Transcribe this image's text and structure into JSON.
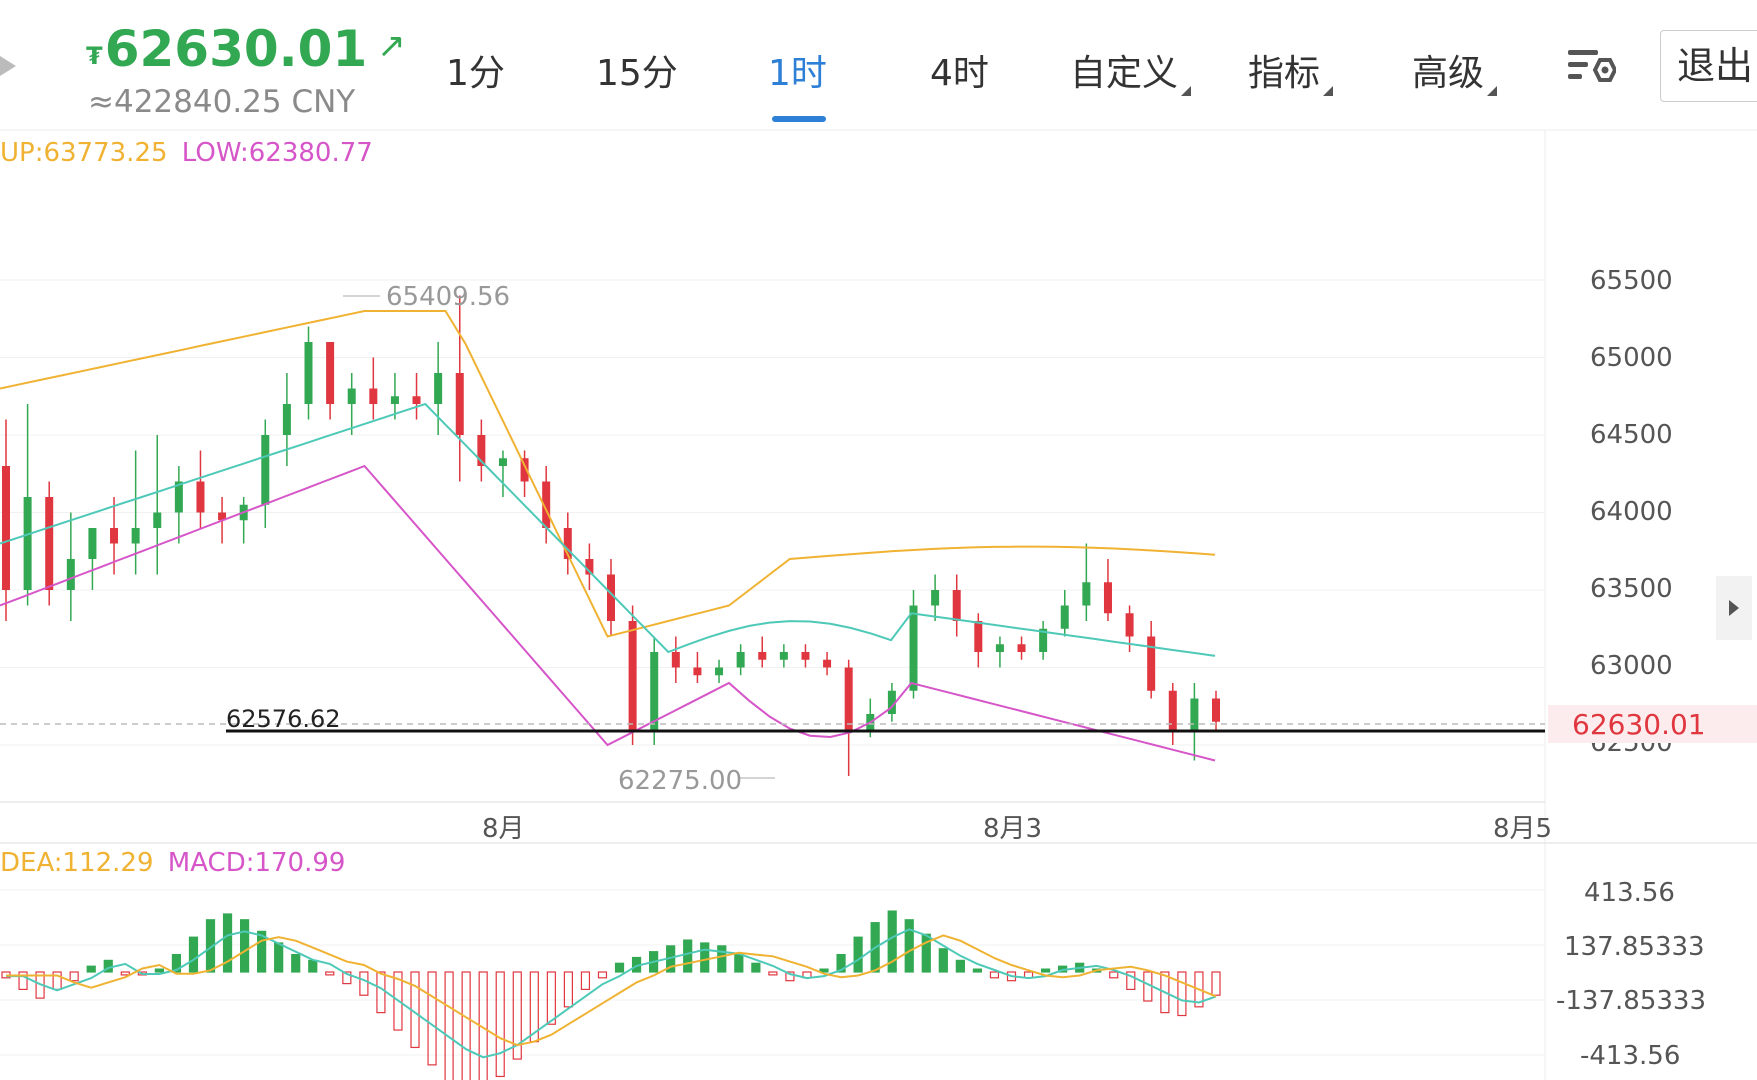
{
  "header": {
    "currency_symbol": "₮",
    "price": "62630.01",
    "trend_icon": "arrow-up-right-icon",
    "cny_value": "≈422840.25 CNY",
    "exit_label": "退出"
  },
  "tabs": [
    {
      "label": "1分"
    },
    {
      "label": "15分"
    },
    {
      "label": "1时",
      "active": true
    },
    {
      "label": "4时"
    },
    {
      "label": "自定义",
      "dropdown": true
    },
    {
      "label": "指标",
      "dropdown": true
    },
    {
      "label": "高级",
      "dropdown": true
    }
  ],
  "colors": {
    "up": "#32a852",
    "down": "#e0363f",
    "boll_up": "#f0b232",
    "boll_mid": "#4ec9b8",
    "boll_low": "#d655c8",
    "active_tab": "#2e7fd6"
  },
  "main_chart": {
    "legend_up": "UP:63773.25",
    "legend_low": "LOW:62380.77",
    "y_ticks": [
      "65500",
      "65000",
      "64500",
      "64000",
      "63500",
      "63000",
      "62500"
    ],
    "x_ticks": [
      "8月",
      "8月3",
      "8月5"
    ],
    "high_marker": "65409.56",
    "low_marker": "62275.00",
    "horizontal_line_label": "62576.62",
    "current_price": "62630.01"
  },
  "macd_chart": {
    "legend_dea": "DEA:112.29",
    "legend_macd": "MACD:170.99",
    "y_ticks": [
      "413.56",
      "137.85333",
      "-137.85333",
      "-413.56"
    ]
  },
  "chart_data": [
    {
      "type": "candlestick",
      "title": "",
      "ylim": [
        62250,
        65600
      ],
      "candles_ohlc_approx": [
        [
          64300,
          64600,
          63300,
          63500
        ],
        [
          63500,
          64700,
          63400,
          64100
        ],
        [
          64100,
          64200,
          63400,
          63500
        ],
        [
          63500,
          64000,
          63300,
          63700
        ],
        [
          63700,
          63900,
          63500,
          63900
        ],
        [
          63900,
          64100,
          63600,
          63800
        ],
        [
          63800,
          64400,
          63600,
          63900
        ],
        [
          63900,
          64500,
          63600,
          64000
        ],
        [
          64000,
          64300,
          63800,
          64200
        ],
        [
          64200,
          64400,
          63900,
          64000
        ],
        [
          64000,
          64100,
          63800,
          63950
        ],
        [
          63950,
          64100,
          63800,
          64050
        ],
        [
          64050,
          64600,
          63900,
          64500
        ],
        [
          64500,
          64900,
          64300,
          64700
        ],
        [
          64700,
          65200,
          64600,
          65100
        ],
        [
          65100,
          65100,
          64600,
          64700
        ],
        [
          64700,
          64900,
          64500,
          64800
        ],
        [
          64800,
          65000,
          64600,
          64700
        ],
        [
          64700,
          64900,
          64600,
          64750
        ],
        [
          64750,
          64900,
          64600,
          64700
        ],
        [
          64700,
          65100,
          64500,
          64900
        ],
        [
          64900,
          65400,
          64200,
          64500
        ],
        [
          64500,
          64600,
          64200,
          64300
        ],
        [
          64300,
          64400,
          64100,
          64350
        ],
        [
          64350,
          64400,
          64100,
          64200
        ],
        [
          64200,
          64300,
          63800,
          63900
        ],
        [
          63900,
          64000,
          63600,
          63700
        ],
        [
          63700,
          63800,
          63500,
          63600
        ],
        [
          63600,
          63700,
          63200,
          63300
        ],
        [
          63300,
          63400,
          62500,
          62600
        ],
        [
          62600,
          63200,
          62500,
          63100
        ],
        [
          63100,
          63200,
          62900,
          63000
        ],
        [
          63000,
          63100,
          62900,
          62950
        ],
        [
          62950,
          63050,
          62900,
          63000
        ],
        [
          63000,
          63150,
          62950,
          63100
        ],
        [
          63100,
          63200,
          63000,
          63050
        ],
        [
          63050,
          63150,
          63000,
          63100
        ],
        [
          63100,
          63150,
          63000,
          63050
        ],
        [
          63050,
          63100,
          62950,
          63000
        ],
        [
          63000,
          63050,
          62300,
          62600
        ],
        [
          62600,
          62800,
          62550,
          62700
        ],
        [
          62700,
          62900,
          62650,
          62850
        ],
        [
          62850,
          63500,
          62800,
          63400
        ],
        [
          63400,
          63600,
          63300,
          63500
        ],
        [
          63500,
          63600,
          63200,
          63300
        ],
        [
          63300,
          63350,
          63000,
          63100
        ],
        [
          63100,
          63200,
          63000,
          63150
        ],
        [
          63150,
          63200,
          63050,
          63100
        ],
        [
          63100,
          63300,
          63050,
          63250
        ],
        [
          63250,
          63500,
          63200,
          63400
        ],
        [
          63400,
          63800,
          63300,
          63550
        ],
        [
          63550,
          63700,
          63300,
          63350
        ],
        [
          63350,
          63400,
          63100,
          63200
        ],
        [
          63200,
          63300,
          62800,
          62850
        ],
        [
          62850,
          62900,
          62500,
          62600
        ],
        [
          62600,
          62900,
          62400,
          62800
        ],
        [
          62800,
          62850,
          62600,
          62650
        ]
      ]
    },
    {
      "type": "bar",
      "title": "MACD",
      "ylim": [
        -413.56,
        413.56
      ],
      "values": [
        -20,
        -60,
        -90,
        -60,
        -30,
        20,
        40,
        -10,
        -10,
        10,
        60,
        120,
        180,
        200,
        180,
        140,
        100,
        60,
        40,
        -10,
        -40,
        -80,
        -140,
        -200,
        -260,
        -320,
        -380,
        -420,
        -400,
        -360,
        -300,
        -240,
        -180,
        -120,
        -60,
        -20,
        30,
        50,
        70,
        90,
        110,
        100,
        90,
        60,
        30,
        -10,
        -30,
        -20,
        10,
        60,
        120,
        170,
        210,
        180,
        130,
        80,
        40,
        10,
        -20,
        -30,
        -20,
        10,
        20,
        30,
        10,
        -20,
        -60,
        -100,
        -140,
        -150,
        -120,
        -80
      ]
    }
  ]
}
